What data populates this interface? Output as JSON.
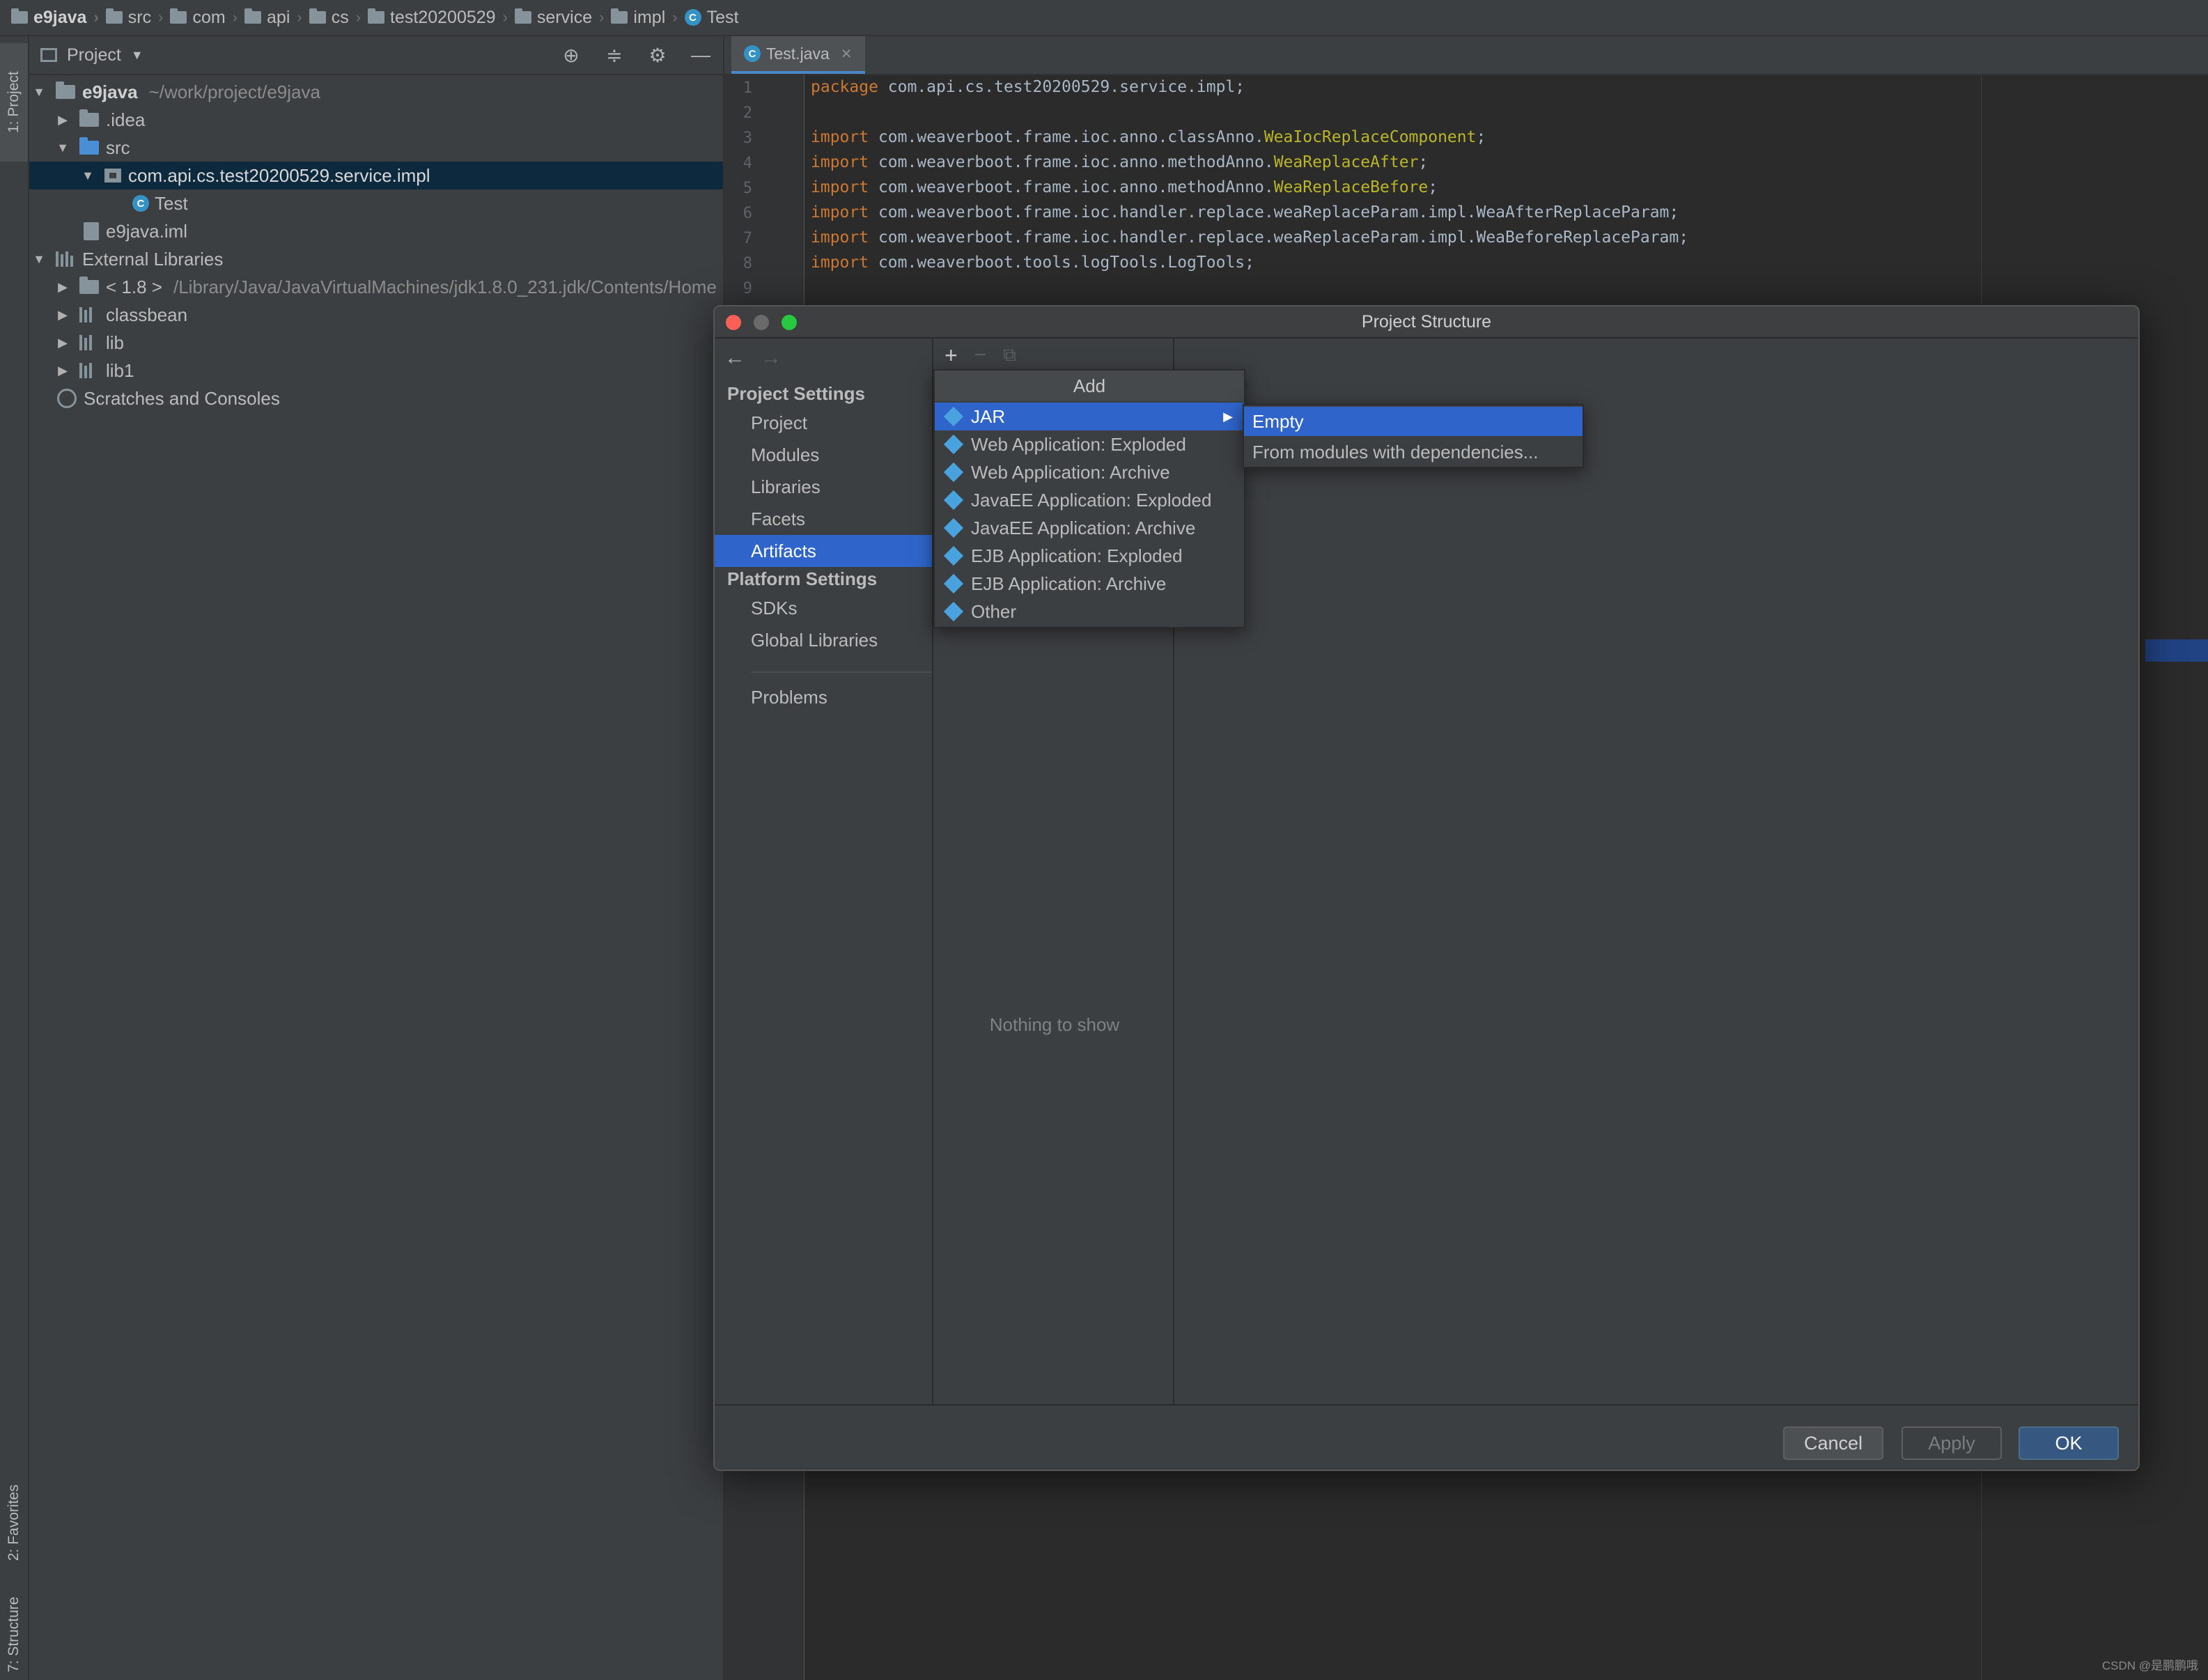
{
  "breadcrumb": [
    "e9java",
    "src",
    "com",
    "api",
    "cs",
    "test20200529",
    "service",
    "impl",
    "Test"
  ],
  "toolstrip": {
    "project_tab": "1: Project",
    "favorites_tab": "2: Favorites",
    "structure_tab": "7: Structure"
  },
  "project_panel": {
    "title": "Project",
    "tree": {
      "root": "e9java",
      "root_path": "~/work/project/e9java",
      "idea": ".idea",
      "src": "src",
      "package": "com.api.cs.test20200529.service.impl",
      "test": "Test",
      "iml": "e9java.iml",
      "external": "External Libraries",
      "jdk": "< 1.8 >",
      "jdk_path": "/Library/Java/JavaVirtualMachines/jdk1.8.0_231.jdk/Contents/Home",
      "classbean": "classbean",
      "lib": "lib",
      "lib1": "lib1",
      "scratches": "Scratches and Consoles"
    }
  },
  "editor": {
    "tab": "Test.java",
    "line_numbers": [
      "1",
      "2",
      "3",
      "4",
      "5",
      "6",
      "7",
      "8",
      "9"
    ],
    "lines": {
      "l1_kw": "package",
      "l1_rest": " com.api.cs.test20200529.service.impl;",
      "l3_kw": "import",
      "l3_rest": " com.weaverboot.frame.ioc.anno.classAnno.",
      "l3_ann": "WeaIocReplaceComponent",
      "l3_end": ";",
      "l4_kw": "import",
      "l4_rest": " com.weaverboot.frame.ioc.anno.methodAnno.",
      "l4_ann": "WeaReplaceAfter",
      "l4_end": ";",
      "l5_kw": "import",
      "l5_rest": " com.weaverboot.frame.ioc.anno.methodAnno.",
      "l5_ann": "WeaReplaceBefore",
      "l5_end": ";",
      "l6_kw": "import",
      "l6_rest": " com.weaverboot.frame.ioc.handler.replace.weaReplaceParam.impl.WeaAfterReplaceParam;",
      "l7_kw": "import",
      "l7_rest": " com.weaverboot.frame.ioc.handler.replace.weaReplaceParam.impl.WeaBeforeReplaceParam;",
      "l8_kw": "import",
      "l8_rest": " com.weaverboot.tools.logTools.LogTools;"
    }
  },
  "dialog": {
    "title": "Project Structure",
    "nav": {
      "project_settings": "Project Settings",
      "project": "Project",
      "modules": "Modules",
      "libraries": "Libraries",
      "facets": "Facets",
      "artifacts": "Artifacts",
      "platform_settings": "Platform Settings",
      "sdks": "SDKs",
      "global_libraries": "Global Libraries",
      "problems": "Problems"
    },
    "mid": {
      "add_symbol": "+",
      "remove_symbol": "−",
      "copy_symbol": "⧉",
      "empty_text": "Nothing to show"
    },
    "buttons": {
      "cancel": "Cancel",
      "apply": "Apply",
      "ok": "OK"
    }
  },
  "add_menu": {
    "title": "Add",
    "items": [
      "JAR",
      "Web Application: Exploded",
      "Web Application: Archive",
      "JavaEE Application: Exploded",
      "JavaEE Application: Archive",
      "EJB Application: Exploded",
      "EJB Application: Archive",
      "Other"
    ]
  },
  "jar_submenu": {
    "items": [
      "Empty",
      "From modules with dependencies..."
    ]
  },
  "watermark": "CSDN @是鹏鹏哦",
  "colors": {
    "selection": "#2f65ca",
    "keyword": "#cc7832",
    "annotation": "#bbb529",
    "ok_button": "#365880"
  }
}
